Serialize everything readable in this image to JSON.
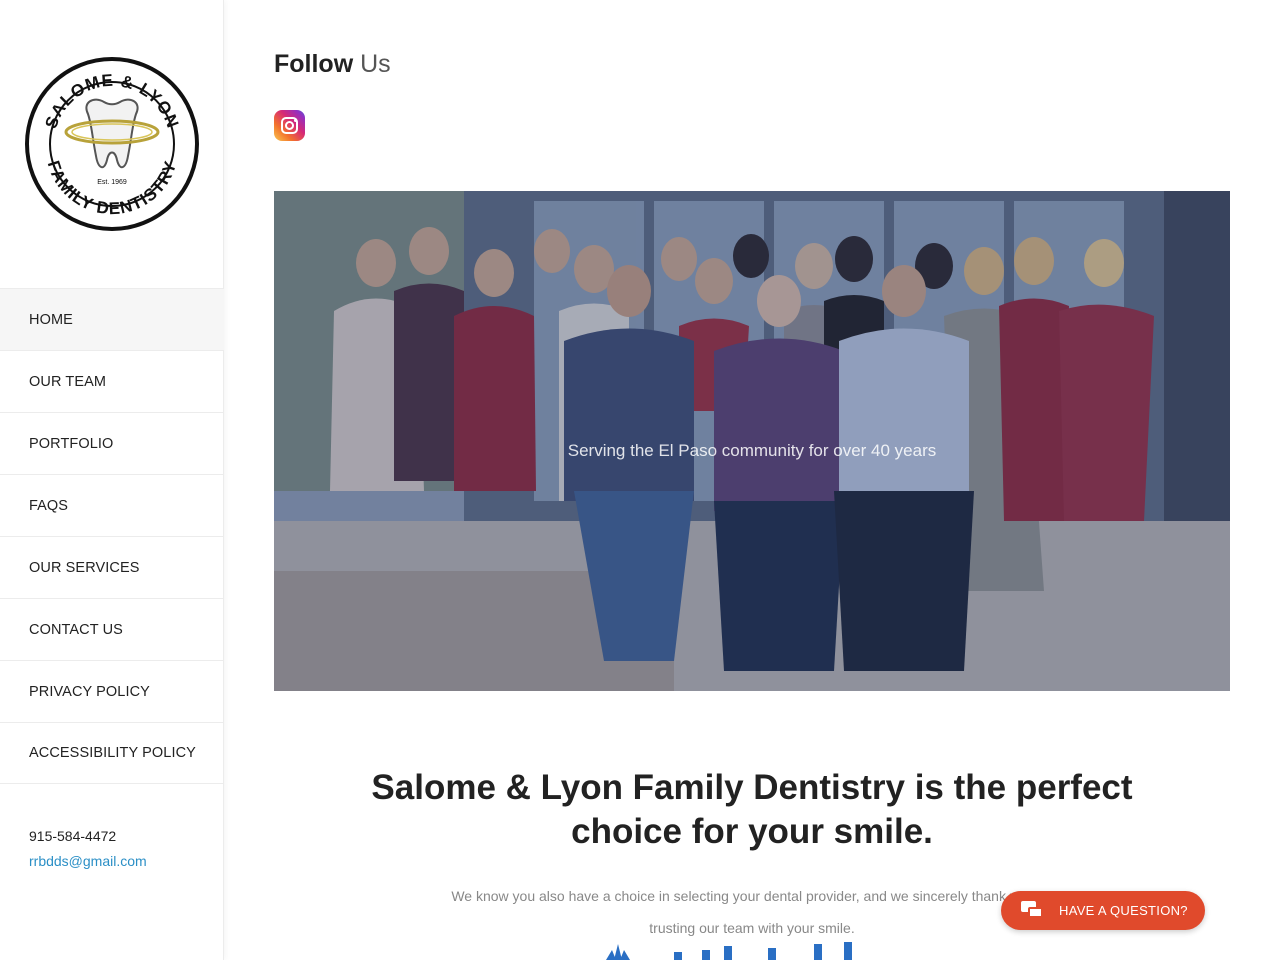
{
  "sidebar": {
    "logo": {
      "top_text": "SALOME & LYON",
      "bottom_text": "FAMILY DENTISTRY",
      "est": "Est. 1969"
    },
    "nav": [
      {
        "label": "HOME",
        "active": true
      },
      {
        "label": "OUR TEAM",
        "active": false
      },
      {
        "label": "PORTFOLIO",
        "active": false
      },
      {
        "label": "FAQS",
        "active": false
      },
      {
        "label": "OUR SERVICES",
        "active": false
      },
      {
        "label": "CONTACT US",
        "active": false
      },
      {
        "label": "PRIVACY POLICY",
        "active": false
      },
      {
        "label": "ACCESSIBILITY POLICY",
        "active": false
      }
    ],
    "contact": {
      "phone": "915-584-4472",
      "email": "rrbdds@gmail.com"
    }
  },
  "main": {
    "follow": {
      "bold": "Follow",
      "light": "Us"
    },
    "social": [
      {
        "icon": "instagram-icon"
      }
    ],
    "hero": {
      "caption": "Serving the El Paso community for over 40 years"
    },
    "headline": "Salome & Lyon Family Dentistry is the perfect choice for your smile.",
    "subtext": "We know you also have a choice in selecting your dental provider, and we sincerely thank you for trusting our team with your smile."
  },
  "chat": {
    "label": "HAVE A QUESTION?",
    "icon": "chat-bubbles-icon"
  },
  "colors": {
    "accent": "#e04a2c",
    "link": "#2b8fc6",
    "logo_gold": "#b8a23a"
  }
}
